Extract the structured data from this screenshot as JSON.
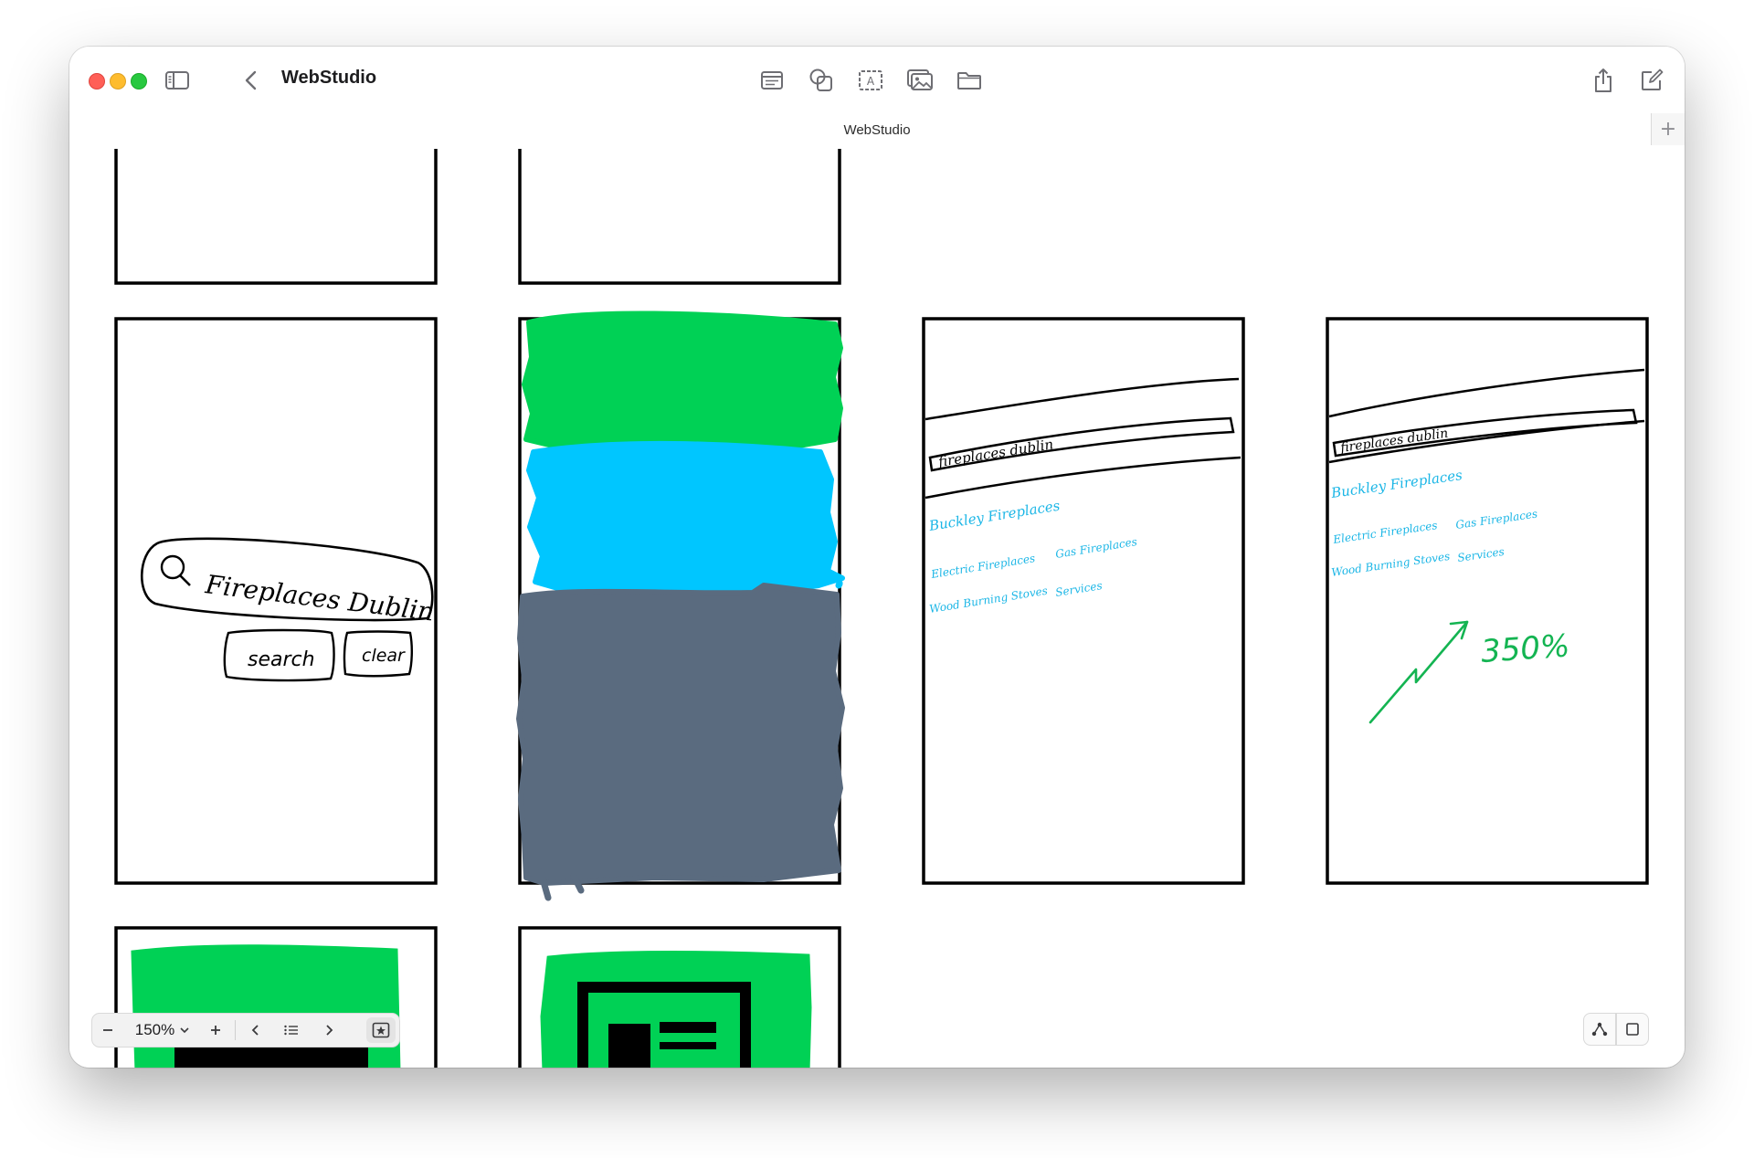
{
  "window": {
    "title": "WebStudio"
  },
  "tab": {
    "label": "WebStudio",
    "add_label": "+"
  },
  "toolbar": {
    "left_icons": [
      "sidebar-toggle-icon",
      "back-chevron-icon"
    ],
    "center_icons": [
      "text-note-icon",
      "shapes-icon",
      "text-box-icon",
      "media-icon",
      "folder-icon"
    ],
    "right_icons": [
      "share-icon",
      "compose-icon"
    ]
  },
  "sketches": {
    "search": {
      "query": "Fireplaces Dublin",
      "search_button": "search",
      "clear_button": "clear"
    },
    "results_left": {
      "query": "fireplaces dublin",
      "title": "Buckley Fireplaces",
      "links_row1": [
        "Electric Fireplaces",
        "Gas Fireplaces"
      ],
      "links_row2": [
        "Wood Burning Stoves",
        "Services"
      ]
    },
    "results_right": {
      "query": "fireplaces dublin",
      "title": "Buckley Fireplaces",
      "links_row1": [
        "Electric Fireplaces",
        "Gas Fireplaces"
      ],
      "links_row2": [
        "Wood Burning Stoves",
        "Services"
      ],
      "growth": "350%"
    }
  },
  "colors": {
    "green": "#00d155",
    "cyan": "#00c6ff",
    "slate": "#5a6b7f",
    "link_blue": "#1bb6e6",
    "growth_green": "#14b452"
  },
  "zoom": {
    "value": "150%"
  }
}
